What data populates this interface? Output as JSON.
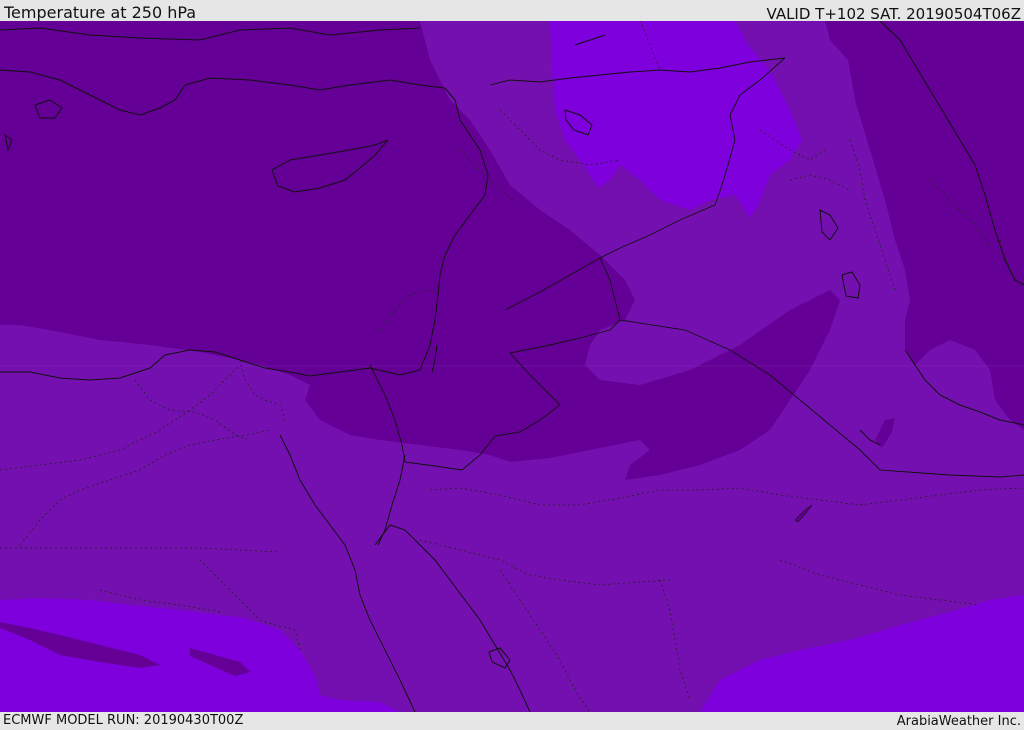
{
  "header": {
    "title": "Temperature at 250 hPa",
    "valid": "VALID T+102 SAT. 20190504T06Z"
  },
  "footer": {
    "model_run": "ECMWF MODEL RUN: 20190430T00Z",
    "credit": "ArabiaWeather Inc."
  },
  "colors": {
    "dark_band": "#650096",
    "mid_band": "#7510b0",
    "light_band": "#7e00dc",
    "lines": "#111111",
    "bar_background": "#e6e6e6"
  },
  "map": {
    "field": "temperature",
    "level": "250 hPa",
    "region": "Eastern Mediterranean, Levant, Egypt, Arabian Peninsula",
    "legend_shown": false
  }
}
